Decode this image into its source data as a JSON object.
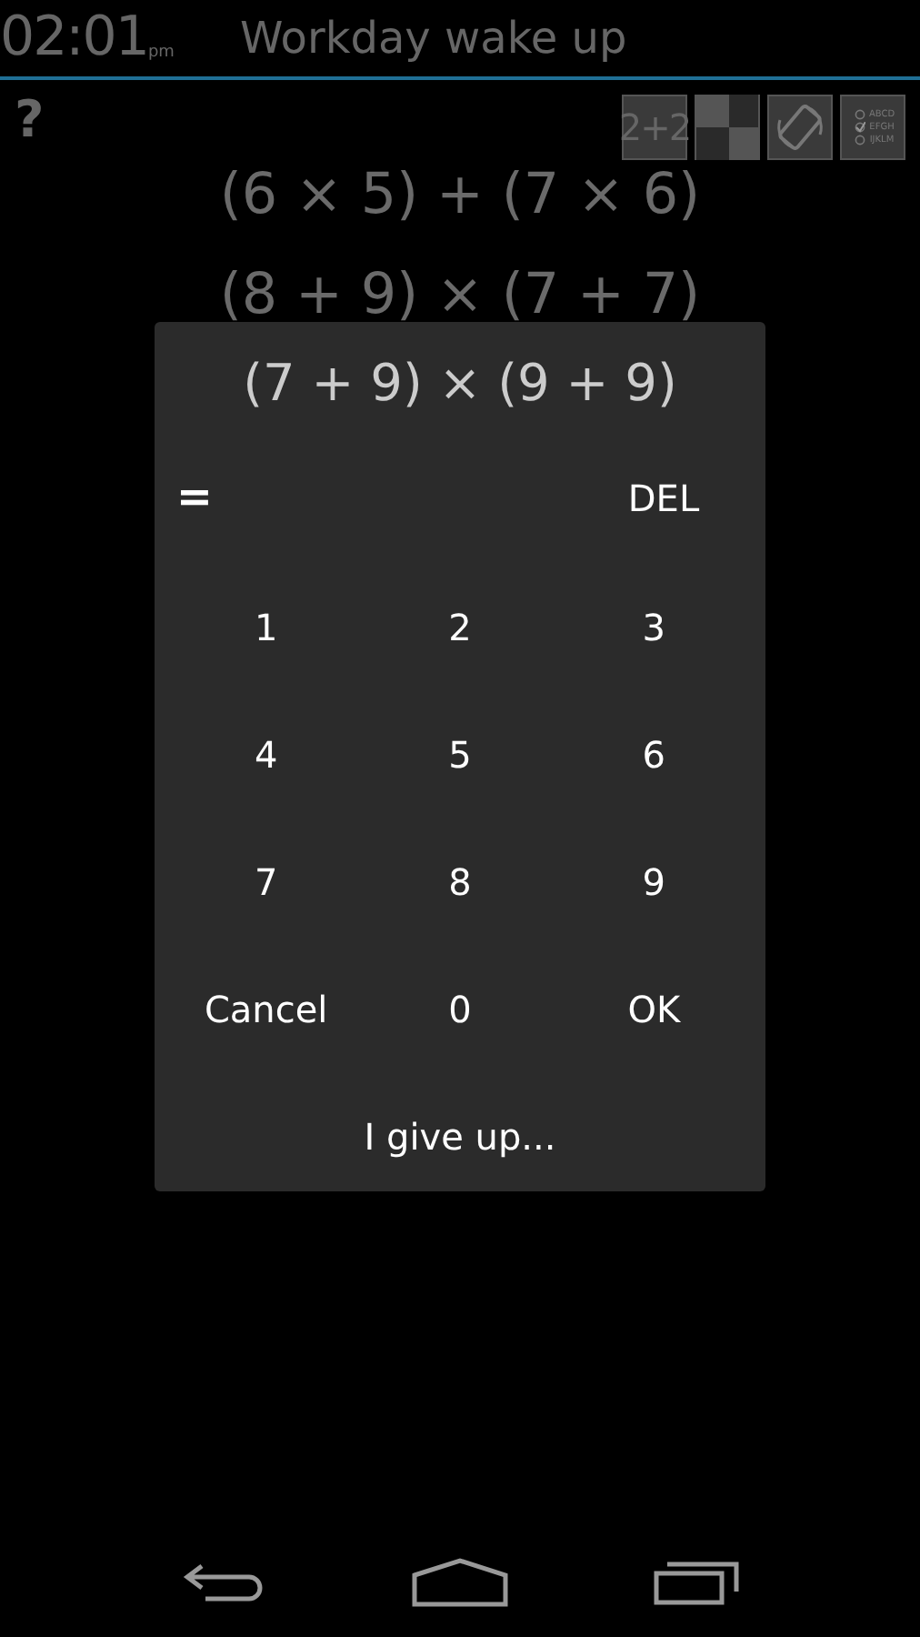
{
  "status": {
    "time": "02:01",
    "ampm": "pm",
    "title": "Workday wake up"
  },
  "help": "?",
  "modes": [
    {
      "kind": "arithmetic",
      "label": "2+2"
    },
    {
      "kind": "tiles"
    },
    {
      "kind": "shake"
    },
    {
      "kind": "quiz",
      "options": [
        {
          "label": "ABCD",
          "checked": false
        },
        {
          "label": "EFGH",
          "checked": true
        },
        {
          "label": "IJKLM",
          "checked": false
        }
      ]
    }
  ],
  "problems": [
    "(6 × 5) + (7 × 6)",
    "(8 + 9) × (7 + 7)"
  ],
  "dialog": {
    "problem": "(7 + 9) × (9 + 9)",
    "answer_prefix": "=",
    "delete": "DEL",
    "keys": [
      "1",
      "2",
      "3",
      "4",
      "5",
      "6",
      "7",
      "8",
      "9",
      "Cancel",
      "0",
      "OK"
    ],
    "give_up": "I give up..."
  }
}
